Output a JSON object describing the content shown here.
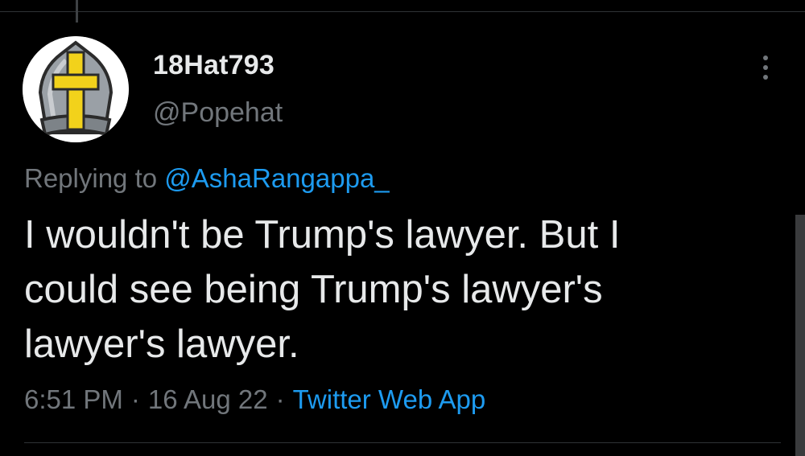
{
  "tweet": {
    "display_name": "18Hat793",
    "handle": "@Popehat",
    "replying_prefix": "Replying to",
    "replying_to": "@AshaRangappa_",
    "text": "I wouldn't be Trump's lawyer. But I\ncould see being Trump's lawyer's\nlawyer's lawyer.",
    "time": "6:51 PM",
    "date": "16 Aug 22",
    "separator": "·",
    "source": "Twitter Web App",
    "avatar_icon": "mitre-cross-icon",
    "more_icon": "more-vertical-icon"
  },
  "colors": {
    "background": "#000000",
    "primary_text": "#e7e9ea",
    "secondary_text": "#71767b",
    "link": "#1d9bf0",
    "avatar_cross": "#f2d21b"
  }
}
